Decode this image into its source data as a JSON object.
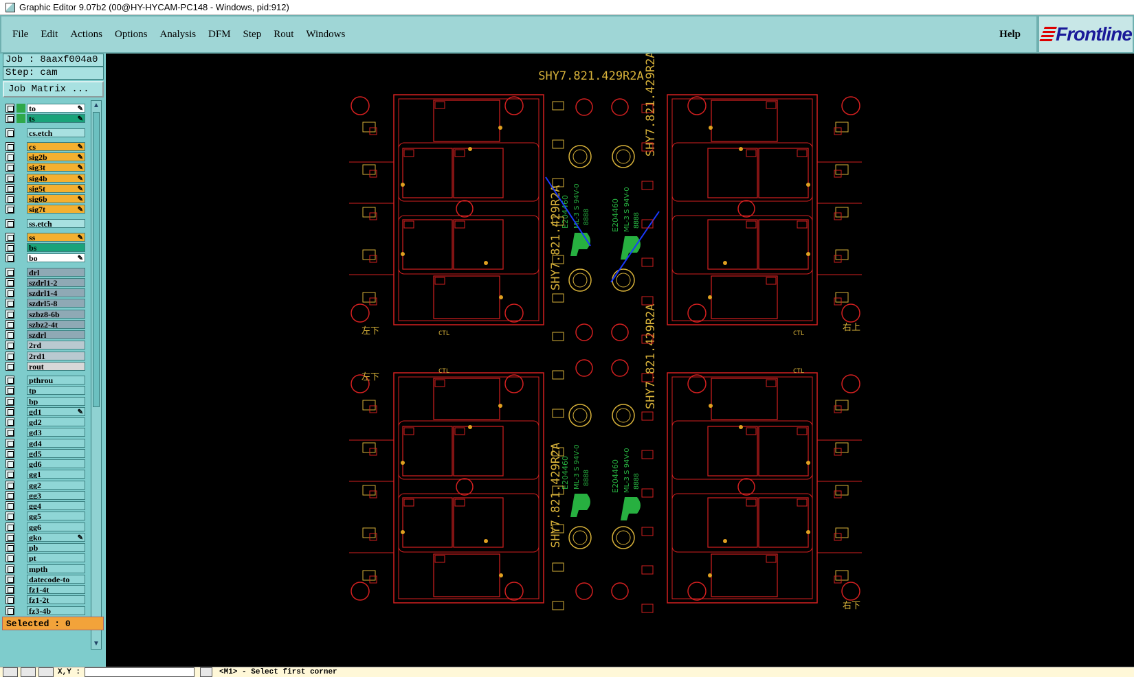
{
  "window": {
    "title": "Graphic Editor 9.07b2 (00@HY-HYCAM-PC148 - Windows, pid:912)"
  },
  "menubar": {
    "items": [
      "File",
      "Edit",
      "Actions",
      "Options",
      "Analysis",
      "DFM",
      "Step",
      "Rout",
      "Windows"
    ],
    "help": "Help",
    "logo": "Frontline"
  },
  "info": {
    "job": "Job : 8aaxf004a0",
    "step": "Step: cam",
    "job_matrix": "Job Matrix ..."
  },
  "layers": [
    {
      "name": "to",
      "color": "#ffffff",
      "swatch": "#2fa84a",
      "pen": true
    },
    {
      "name": "ts",
      "color": "#1aa37a",
      "swatch": "#2fa84a",
      "pen": true
    },
    {
      "name": "cs.etch",
      "color": "#a8e1e1",
      "swatch": "",
      "pen": false
    },
    {
      "name": "cs",
      "color": "#f4b030",
      "swatch": "",
      "pen": true
    },
    {
      "name": "sig2b",
      "color": "#f4b030",
      "swatch": "",
      "pen": true
    },
    {
      "name": "sig3t",
      "color": "#f4b030",
      "swatch": "",
      "pen": true
    },
    {
      "name": "sig4b",
      "color": "#f4b030",
      "swatch": "",
      "pen": true
    },
    {
      "name": "sig5t",
      "color": "#f4b030",
      "swatch": "",
      "pen": true
    },
    {
      "name": "sig6b",
      "color": "#f4b030",
      "swatch": "",
      "pen": true
    },
    {
      "name": "sig7t",
      "color": "#f4b030",
      "swatch": "",
      "pen": true
    },
    {
      "name": "ss.etch",
      "color": "#a8e1e1",
      "swatch": "",
      "pen": false
    },
    {
      "name": "ss",
      "color": "#f4b030",
      "swatch": "",
      "pen": true
    },
    {
      "name": "bs",
      "color": "#1aa37a",
      "swatch": "",
      "pen": false
    },
    {
      "name": "bo",
      "color": "#ffffff",
      "swatch": "",
      "pen": true
    },
    {
      "name": "drl",
      "color": "#8fa9b5",
      "swatch": "",
      "pen": false
    },
    {
      "name": "szdrl1-2",
      "color": "#8fa9b5",
      "swatch": "",
      "pen": false
    },
    {
      "name": "szdrl1-4",
      "color": "#8fa9b5",
      "swatch": "",
      "pen": false
    },
    {
      "name": "szdrl5-8",
      "color": "#8fa9b5",
      "swatch": "",
      "pen": false
    },
    {
      "name": "szbz8-6b",
      "color": "#8fa9b5",
      "swatch": "",
      "pen": false
    },
    {
      "name": "szbz2-4t",
      "color": "#8fa9b5",
      "swatch": "",
      "pen": false
    },
    {
      "name": "szdrl",
      "color": "#8fa9b5",
      "swatch": "",
      "pen": false
    },
    {
      "name": "2rd",
      "color": "#b9c9d0",
      "swatch": "",
      "pen": false
    },
    {
      "name": "2rd1",
      "color": "#b9c9d0",
      "swatch": "",
      "pen": false
    },
    {
      "name": "rout",
      "color": "#d8d8d8",
      "swatch": "",
      "pen": false
    },
    {
      "name": "pthrou",
      "color": "#8fd6d6",
      "swatch": "",
      "pen": false
    },
    {
      "name": "tp",
      "color": "#8fd6d6",
      "swatch": "",
      "pen": false
    },
    {
      "name": "bp",
      "color": "#8fd6d6",
      "swatch": "",
      "pen": false
    },
    {
      "name": "gd1",
      "color": "#8fd6d6",
      "swatch": "",
      "pen": true
    },
    {
      "name": "gd2",
      "color": "#8fd6d6",
      "swatch": "",
      "pen": false
    },
    {
      "name": "gd3",
      "color": "#8fd6d6",
      "swatch": "",
      "pen": false
    },
    {
      "name": "gd4",
      "color": "#8fd6d6",
      "swatch": "",
      "pen": false
    },
    {
      "name": "gd5",
      "color": "#8fd6d6",
      "swatch": "",
      "pen": false
    },
    {
      "name": "gd6",
      "color": "#8fd6d6",
      "swatch": "",
      "pen": false
    },
    {
      "name": "gg1",
      "color": "#8fd6d6",
      "swatch": "",
      "pen": false
    },
    {
      "name": "gg2",
      "color": "#8fd6d6",
      "swatch": "",
      "pen": false
    },
    {
      "name": "gg3",
      "color": "#8fd6d6",
      "swatch": "",
      "pen": false
    },
    {
      "name": "gg4",
      "color": "#8fd6d6",
      "swatch": "",
      "pen": false
    },
    {
      "name": "gg5",
      "color": "#8fd6d6",
      "swatch": "",
      "pen": false
    },
    {
      "name": "gg6",
      "color": "#8fd6d6",
      "swatch": "",
      "pen": false
    },
    {
      "name": "gko",
      "color": "#8fd6d6",
      "swatch": "",
      "pen": true
    },
    {
      "name": "pb",
      "color": "#8fd6d6",
      "swatch": "",
      "pen": false
    },
    {
      "name": "pt",
      "color": "#8fd6d6",
      "swatch": "",
      "pen": false
    },
    {
      "name": "mpth",
      "color": "#8fd6d6",
      "swatch": "",
      "pen": false
    },
    {
      "name": "datecode-to",
      "color": "#8fd6d6",
      "swatch": "",
      "pen": false
    },
    {
      "name": "fz1-4t",
      "color": "#8fd6d6",
      "swatch": "",
      "pen": false
    },
    {
      "name": "fz1-2t",
      "color": "#8fd6d6",
      "swatch": "",
      "pen": false
    },
    {
      "name": "fz3-4b",
      "color": "#8fd6d6",
      "swatch": "",
      "pen": false
    }
  ],
  "status": {
    "selected": "Selected : 0",
    "xy_label": "X,Y :",
    "prompt": "<M1> - Select first corner"
  },
  "board": {
    "title": "SHY7.821.429R2A",
    "vertical_label": "SHY7.821.429R2A",
    "code": "E204460",
    "rating": "ML-3 S 94V-0",
    "datecode": "8888",
    "ctl": "CTL",
    "corner_tl": "左下",
    "corner_tr": "右上",
    "corner_bl": "左下",
    "corner_br": "右下",
    "outline_color": "#d42020",
    "text_color": "#d8b23a",
    "green_color": "#27b040",
    "pad_color": "#e0a020"
  }
}
